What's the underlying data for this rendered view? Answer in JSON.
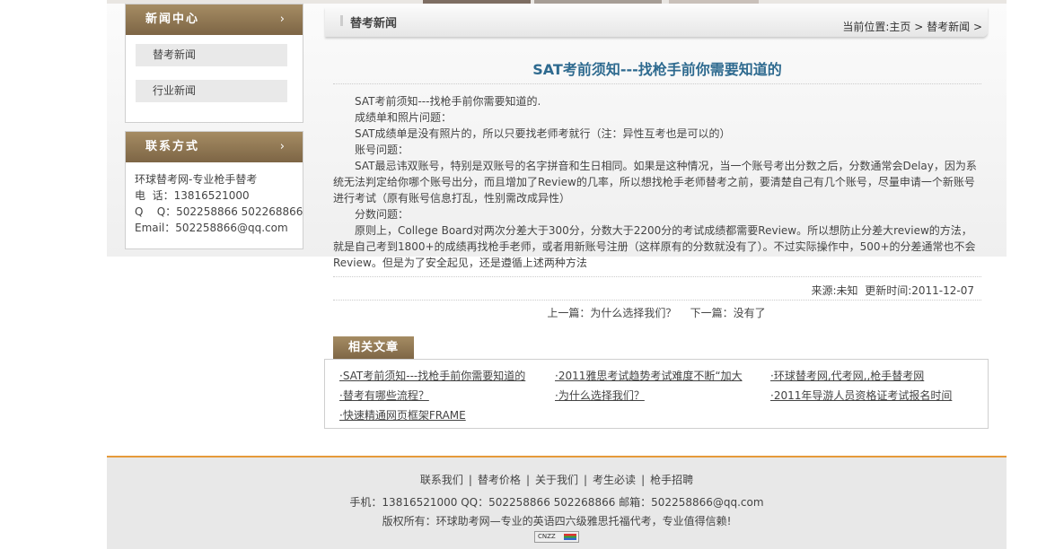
{
  "sidebar": {
    "news_center": {
      "title": "新闻中心",
      "arrow": "›",
      "items": [
        {
          "label": "替考新闻"
        },
        {
          "label": "行业新闻"
        }
      ]
    },
    "contact": {
      "title": "联系方式",
      "arrow": "›",
      "company": "环球替考网-专业枪手替考",
      "phone": "电  话：13816521000",
      "qq": "Q    Q：502258866 502268866",
      "email": "Email：502258866@qq.com"
    }
  },
  "main": {
    "section_title": "替考新闻",
    "breadcrumb": {
      "prefix": "当前位置:",
      "home": "主页",
      "sep": " > ",
      "current": "替考新闻",
      "suffix": " >"
    },
    "article": {
      "title": "SAT考前须知---找枪手前你需要知道的",
      "paragraphs": [
        "SAT考前须知---找枪手前你需要知道的.",
        "成绩单和照片问题：",
        "SAT成绩单是没有照片的，所以只要找老师考就行（注：异性互考也是可以的）",
        "账号问题：",
        "SAT最忌讳双账号，特别是双账号的名字拼音和生日相同。如果是这种情况，当一个账号考出分数之后，分数通常会Delay，因为系统无法判定给你哪个账号出分，而且增加了Review的几率，所以想找枪手老师替考之前，要清楚自己有几个账号，尽量申请一个新账号进行考试（原有账号信息打乱，性别需改成异性）",
        "分数问题：",
        "原则上，College Board对两次分差大于300分，分数大于2200分的考试成绩都需要Review。所以想防止分差大review的方法，就是自己考到1800+的成绩再找枪手老师，或者用新账号注册（这样原有的分数就没有了）。不过实际操作中，500+的分差通常也不会Review。但是为了安全起见，还是遵循上述两种方法"
      ],
      "source": "来源:未知",
      "updated": "更新时间:2011-12-07"
    },
    "prev_label": "上一篇：",
    "prev_link": "为什么选择我们？",
    "next_label": "下一篇：",
    "next_link": "没有了",
    "related": {
      "title": "相关文章",
      "items": [
        "·SAT考前须知---找枪手前你需要知道的",
        "·2011雅思考试趋势考试难度不断“加大",
        "·环球替考网,代考网,,枪手替考网",
        "·替考有哪些流程？",
        "·为什么选择我们？",
        "·2011年导游人员资格证考试报名时间",
        "·快速精通网页框架FRAME"
      ]
    }
  },
  "footer": {
    "links": [
      "联系我们",
      "替考价格",
      "关于我们",
      "考生必读",
      "枪手招聘"
    ],
    "separator": "|",
    "contact_line": "手机：13816521000 QQ：502258866 502268866 邮箱：502258866@qq.com",
    "copyright": "版权所有：环球助考网—专业的英语四六级雅思托福代考，专业值得信赖!",
    "badge": "CNZZ"
  },
  "colors": {
    "brown_header": "#8e7652",
    "title_blue": "#2e6a8f",
    "footer_accent": "#e69a3a"
  }
}
